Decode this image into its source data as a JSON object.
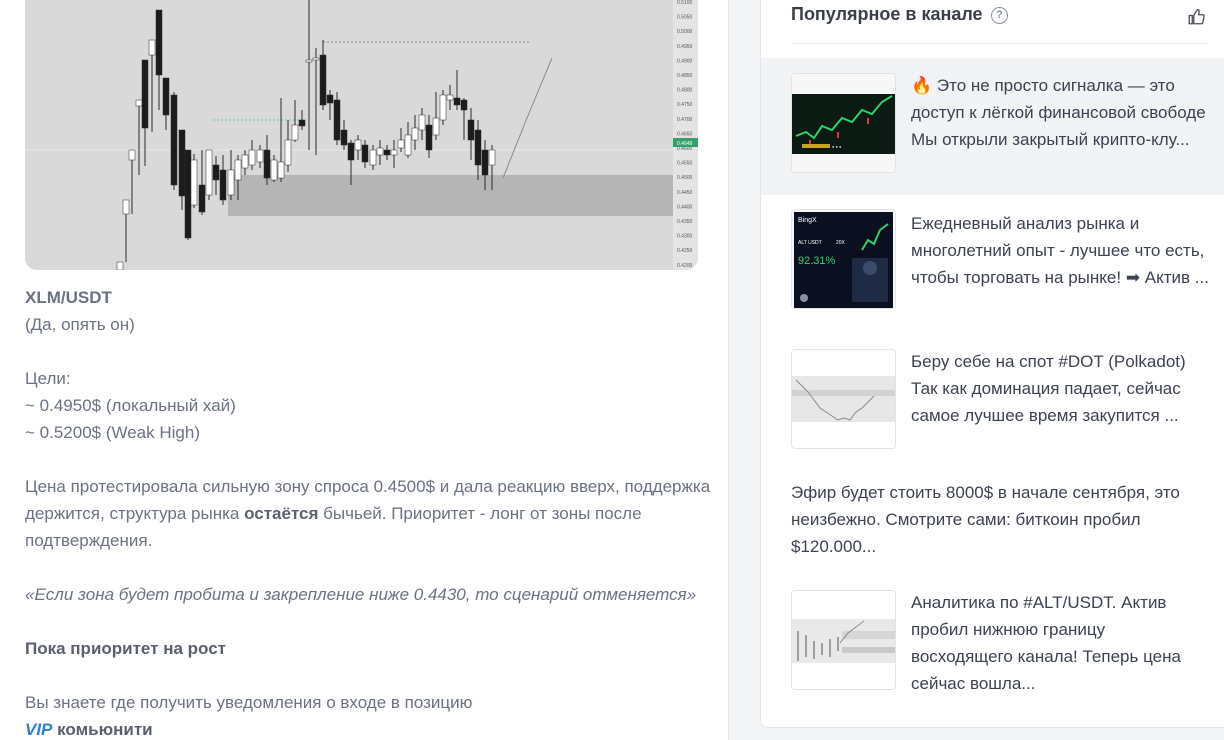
{
  "post": {
    "title": "XLM/USDT",
    "subtitle": "(Да, опять он)",
    "targets_label": "Цели:",
    "target1": "~ 0.4950$ (локальный хай)",
    "target2": "~ 0.5200$ (Weak High)",
    "para_part1": "Цена протестировала сильную зону спроса 0.4500$ и дала реакцию вверх, поддержка держится, структура рынка ",
    "para_bold": "остаётся",
    "para_part2": " бычьей. Приоритет - лонг от зоны после подтверждения.",
    "quote": "«Если зона будет пробита и закрепление ниже 0.4430, то сценарий отменяется»",
    "priority": "Пока приоритет на рост",
    "notify": "Вы знаете где получить уведомления о входе в позицию",
    "vip": "VIP",
    "community": " комьюнити"
  },
  "chart": {
    "price_labels": [
      "0.5100",
      "0.5050",
      "0.5000",
      "0.4950",
      "0.4900",
      "0.4850",
      "0.4800",
      "0.4750",
      "0.4700",
      "0.4650",
      "0.4600",
      "0.4550",
      "0.4500",
      "0.4450",
      "0.4400",
      "0.4350",
      "0.4300",
      "0.4250",
      "0.4200"
    ],
    "current_price": "0.4648",
    "zone_color": "#b5b5b5",
    "up_color": "#ffffff",
    "down_color": "#1c1c1c"
  },
  "sidebar": {
    "title": "Популярное в канале",
    "help": "?",
    "items": [
      {
        "emoji": "🔥",
        "text": " Это не просто сигналка — это доступ к лёгкой финансовой свободе Мы открыли закрытый крипто-клу...",
        "thumb": "dark-chart"
      },
      {
        "text": "Ежедневный анализ рынка и многолетний опыт - лучшее что есть, чтобы торговать на рынке! ➡ Актив ...",
        "thumb": "bingx-card"
      },
      {
        "text": "Беру себе на спот #DOT (Polkadot) Так как доминация падает, сейчас самое лучшее время закупится ...",
        "thumb": "light-chart"
      },
      {
        "text": "Эфир будет стоить 8000$ в начале сентября, это неизбежно. Смотрите сами: биткоин пробил $120.000..."
      },
      {
        "text": "Аналитика по #ALT/USDT. Актив пробил нижнюю границу восходящего канала! Теперь цена сейчас вошла...",
        "thumb": "light-chart-2"
      }
    ],
    "bingx": {
      "brand": "BingX",
      "pair": "ALT USDT",
      "lev": "20X",
      "pct": "92.31%"
    }
  }
}
